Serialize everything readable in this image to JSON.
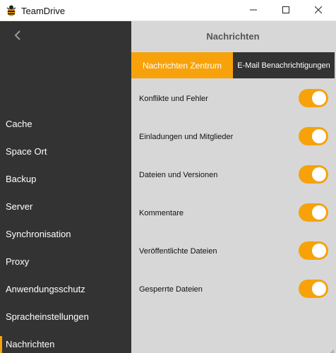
{
  "window": {
    "title": "TeamDrive",
    "icon": "teamdrive-bee-icon",
    "controls": [
      "minimize-icon",
      "maximize-icon",
      "close-icon"
    ]
  },
  "sidebar": {
    "back_icon": "chevron-left-icon",
    "items": [
      {
        "label": "Cache",
        "active": false
      },
      {
        "label": "Space Ort",
        "active": false
      },
      {
        "label": "Backup",
        "active": false
      },
      {
        "label": "Server",
        "active": false
      },
      {
        "label": "Synchronisation",
        "active": false
      },
      {
        "label": "Proxy",
        "active": false
      },
      {
        "label": "Anwendungsschutz",
        "active": false
      },
      {
        "label": "Spracheinstellungen",
        "active": false
      },
      {
        "label": "Nachrichten",
        "active": true
      }
    ]
  },
  "main": {
    "title": "Nachrichten",
    "tabs": [
      {
        "label": "Nachrichten Zentrum",
        "active": true
      },
      {
        "label": "E-Mail Benachrichtigungen",
        "active": false
      }
    ],
    "settings": [
      {
        "label": "Konflikte und Fehler",
        "enabled": true
      },
      {
        "label": "Einladungen und Mitglieder",
        "enabled": true
      },
      {
        "label": "Dateien und Versionen",
        "enabled": true
      },
      {
        "label": "Kommentare",
        "enabled": true
      },
      {
        "label": "Veröffentlichte Dateien",
        "enabled": true
      },
      {
        "label": "Gesperrte Dateien",
        "enabled": true
      }
    ]
  },
  "colors": {
    "accent": "#f7a20a",
    "sidebar_bg": "#333333",
    "panel_bg": "#d7d7d7",
    "toggle_knob": "#ffffff"
  }
}
